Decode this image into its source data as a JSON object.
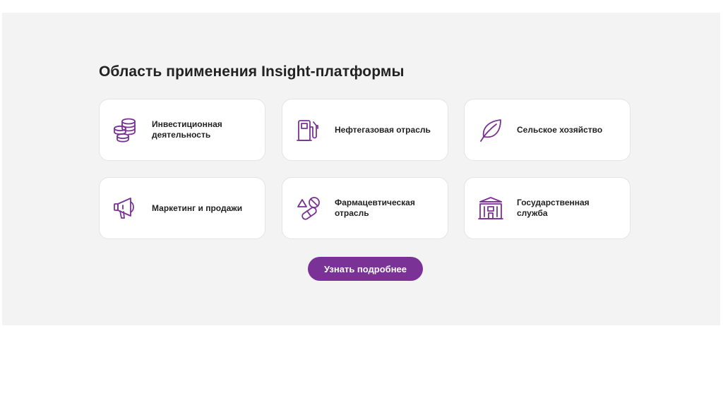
{
  "section": {
    "title": "Область применения Insight-платформы"
  },
  "cards": [
    {
      "label": "Инвестиционная деятельность",
      "icon": "coins-stack-icon"
    },
    {
      "label": "Нефтегазовая отрасль",
      "icon": "fuel-pump-icon"
    },
    {
      "label": "Сельское хозяйство",
      "icon": "leaf-icon"
    },
    {
      "label": "Маркетинг и продажи",
      "icon": "megaphone-icon"
    },
    {
      "label": "Фармацевтическая отрасль",
      "icon": "pills-icon"
    },
    {
      "label": "Государственная служба",
      "icon": "government-building-icon"
    }
  ],
  "cta": {
    "label": "Узнать подробнее"
  },
  "colors": {
    "accent": "#7b3296",
    "panel_bg": "#f3f3f3",
    "card_bg": "#ffffff",
    "text": "#222222"
  }
}
